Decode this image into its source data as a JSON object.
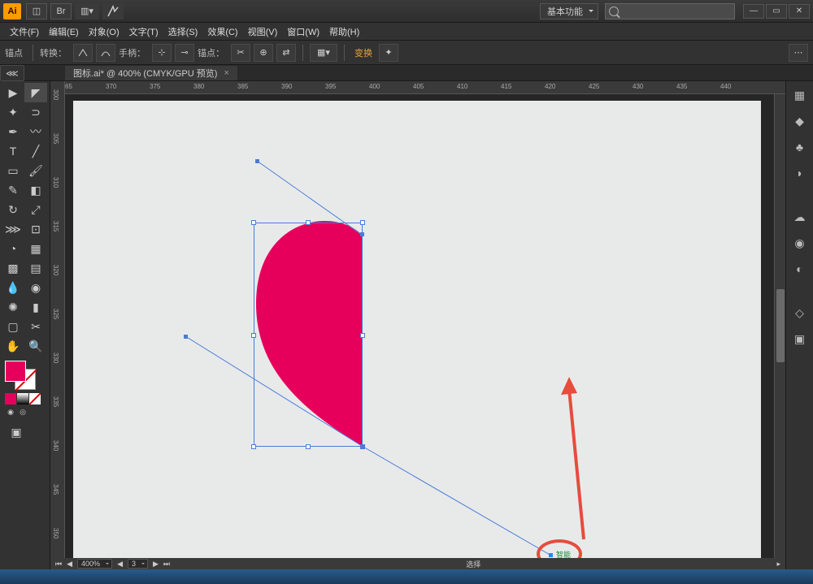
{
  "title_logo": "Ai",
  "workspace": "基本功能",
  "menus": [
    "文件(F)",
    "编辑(E)",
    "对象(O)",
    "文字(T)",
    "选择(S)",
    "效果(C)",
    "视图(V)",
    "窗口(W)",
    "帮助(H)"
  ],
  "ctrl": {
    "label0": "锚点",
    "convert": "转换：",
    "handles": "手柄：",
    "anchor": "锚点：",
    "transform": "变换",
    "transform_color": "#e6a23c"
  },
  "doc_tab": "图标.ai* @ 400% (CMYK/GPU 预览)",
  "ruler_h": [
    "65",
    "370",
    "375",
    "380",
    "385",
    "390",
    "395",
    "400",
    "405",
    "410",
    "415",
    "420",
    "425",
    "430",
    "435",
    "440"
  ],
  "ruler_v": [
    "300",
    "305",
    "310",
    "315",
    "320",
    "325",
    "330",
    "335",
    "340",
    "345",
    "350"
  ],
  "status": {
    "zoom": "400%",
    "artboard": "3",
    "mode": "选择"
  },
  "colors": {
    "fill": "#e6005c",
    "bg": "#e8eaea",
    "selection": "#4a7bd8",
    "annotation": "#e74c3c"
  },
  "cursor_tag": "智能"
}
